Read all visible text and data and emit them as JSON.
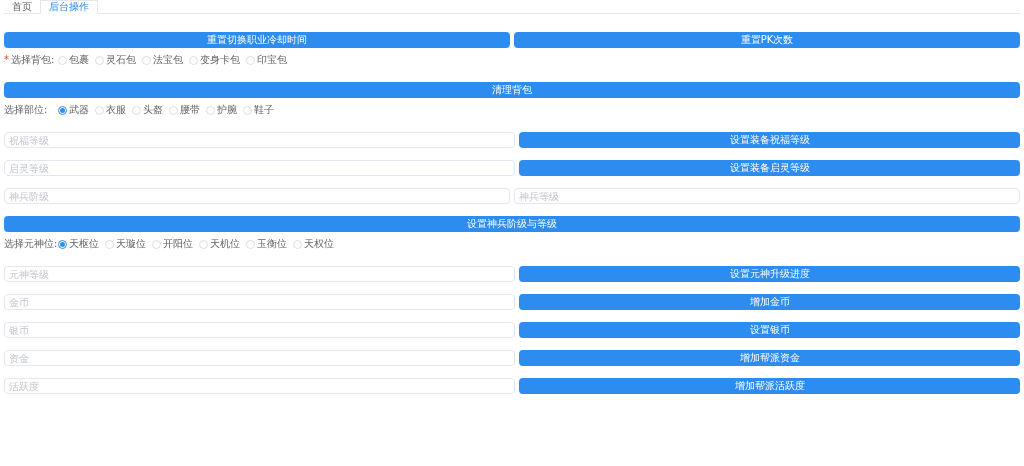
{
  "tabs": [
    {
      "label": "首页",
      "selected": false
    },
    {
      "label": "后台操作",
      "selected": true
    }
  ],
  "rows": [
    {
      "kind": "buttons",
      "buttons": [
        "重置切换职业冷却时间",
        "重置PK次数"
      ]
    },
    {
      "kind": "radios",
      "label": "选择背包:",
      "mark": "*",
      "options": [
        {
          "label": "包裹",
          "selected": false
        },
        {
          "label": "灵石包",
          "selected": false
        },
        {
          "label": "法宝包",
          "selected": false
        },
        {
          "label": "变身卡包",
          "selected": false
        },
        {
          "label": "印宝包",
          "selected": false
        }
      ]
    },
    {
      "kind": "buttons",
      "buttons": [
        "清理背包"
      ]
    },
    {
      "kind": "radios",
      "label": "选择部位:",
      "options": [
        {
          "label": "武器",
          "selected": true
        },
        {
          "label": "衣服",
          "selected": false
        },
        {
          "label": "头盔",
          "selected": false
        },
        {
          "label": "腰带",
          "selected": false
        },
        {
          "label": "护腕",
          "selected": false
        },
        {
          "label": "鞋子",
          "selected": false
        }
      ]
    },
    {
      "kind": "field_button",
      "placeholder": "祝福等级",
      "button": "设置装备祝福等级"
    },
    {
      "kind": "field_button",
      "placeholder": "启灵等级",
      "button": "设置装备启灵等级"
    },
    {
      "kind": "field_field",
      "placeholders": [
        "神兵阶级",
        "神兵等级"
      ]
    },
    {
      "kind": "buttons",
      "buttons": [
        "设置神兵阶级与等级"
      ]
    },
    {
      "kind": "radios",
      "label": "选择元神位:",
      "options": [
        {
          "label": "天枢位",
          "selected": true
        },
        {
          "label": "天璇位",
          "selected": false
        },
        {
          "label": "开阳位",
          "selected": false
        },
        {
          "label": "天机位",
          "selected": false
        },
        {
          "label": "玉衡位",
          "selected": false
        },
        {
          "label": "天权位",
          "selected": false
        }
      ]
    },
    {
      "kind": "field_button",
      "placeholder": "元神等级",
      "button": "设置元神升级进度"
    },
    {
      "kind": "field_button",
      "placeholder": "金币",
      "button": "增加金币"
    },
    {
      "kind": "field_button",
      "placeholder": "银币",
      "button": "设置银币"
    },
    {
      "kind": "field_button",
      "placeholder": "资金",
      "button": "增加帮派资金"
    },
    {
      "kind": "field_button",
      "placeholder": "活跃度",
      "button": "增加帮派活跃度"
    }
  ]
}
